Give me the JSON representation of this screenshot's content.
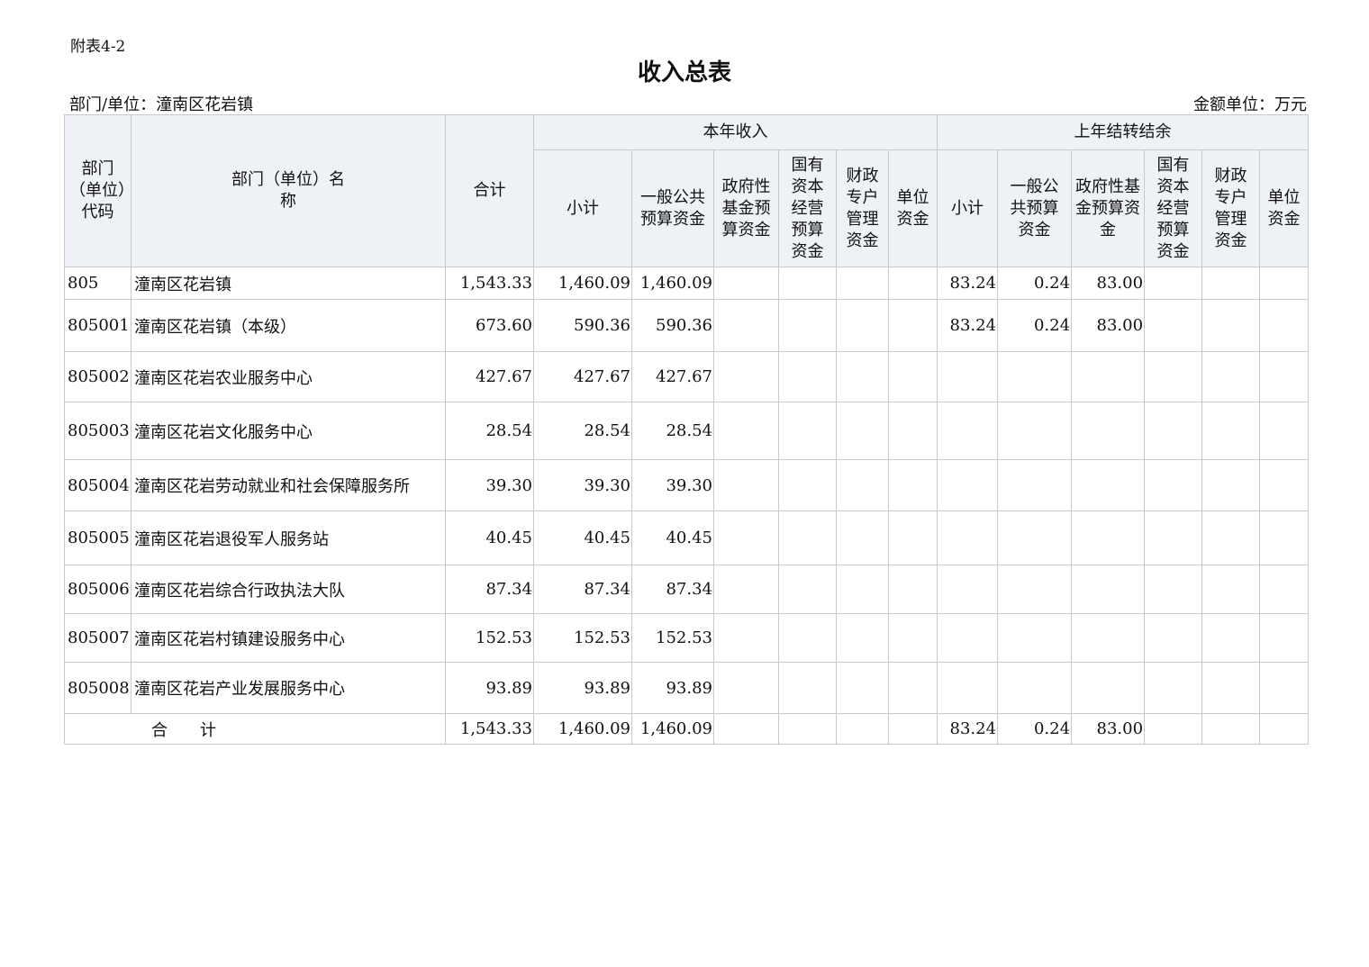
{
  "doc": {
    "attach_label": "附表4-2",
    "title": "收入总表",
    "dept_label": "部门/单位：潼南区花岩镇",
    "unit_label": "金额单位：万元"
  },
  "headers": {
    "code": "部门（单位）代码",
    "name": "部门（单位）名称",
    "total": "合计",
    "current_group": "本年收入",
    "prior_group": "上年结转结余",
    "cur": [
      "小计",
      "一般公共预算资金",
      "政府性基金预算资金",
      "国有资本经营预算资金",
      "财政专户管理资金",
      "单位资金"
    ],
    "prior": [
      "小计",
      "一般公共预算资金",
      "政府性基金预算资金",
      "国有资本经营预算资金",
      "财政专户管理资金",
      "单位资金"
    ]
  },
  "rows": [
    {
      "code": "805",
      "name": "潼南区花岩镇",
      "total": "1,543.33",
      "cur": [
        "1,460.09",
        "1,460.09",
        "",
        "",
        "",
        ""
      ],
      "prior": [
        "83.24",
        "0.24",
        "83.00",
        "",
        "",
        ""
      ]
    },
    {
      "code": "805001",
      "name": "潼南区花岩镇（本级）",
      "total": "673.60",
      "cur": [
        "590.36",
        "590.36",
        "",
        "",
        "",
        ""
      ],
      "prior": [
        "83.24",
        "0.24",
        "83.00",
        "",
        "",
        ""
      ]
    },
    {
      "code": "805002",
      "name": "潼南区花岩农业服务中心",
      "total": "427.67",
      "cur": [
        "427.67",
        "427.67",
        "",
        "",
        "",
        ""
      ],
      "prior": [
        "",
        "",
        "",
        "",
        "",
        ""
      ]
    },
    {
      "code": "805003",
      "name": "潼南区花岩文化服务中心",
      "total": "28.54",
      "cur": [
        "28.54",
        "28.54",
        "",
        "",
        "",
        ""
      ],
      "prior": [
        "",
        "",
        "",
        "",
        "",
        ""
      ]
    },
    {
      "code": "805004",
      "name": "潼南区花岩劳动就业和社会保障服务所",
      "total": "39.30",
      "cur": [
        "39.30",
        "39.30",
        "",
        "",
        "",
        ""
      ],
      "prior": [
        "",
        "",
        "",
        "",
        "",
        ""
      ]
    },
    {
      "code": "805005",
      "name": "潼南区花岩退役军人服务站",
      "total": "40.45",
      "cur": [
        "40.45",
        "40.45",
        "",
        "",
        "",
        ""
      ],
      "prior": [
        "",
        "",
        "",
        "",
        "",
        ""
      ]
    },
    {
      "code": "805006",
      "name": "潼南区花岩综合行政执法大队",
      "total": "87.34",
      "cur": [
        "87.34",
        "87.34",
        "",
        "",
        "",
        ""
      ],
      "prior": [
        "",
        "",
        "",
        "",
        "",
        ""
      ]
    },
    {
      "code": "805007",
      "name": "潼南区花岩村镇建设服务中心",
      "total": "152.53",
      "cur": [
        "152.53",
        "152.53",
        "",
        "",
        "",
        ""
      ],
      "prior": [
        "",
        "",
        "",
        "",
        "",
        ""
      ]
    },
    {
      "code": "805008",
      "name": "潼南区花岩产业发展服务中心",
      "total": "93.89",
      "cur": [
        "93.89",
        "93.89",
        "",
        "",
        "",
        ""
      ],
      "prior": [
        "",
        "",
        "",
        "",
        "",
        ""
      ]
    }
  ],
  "total_row": {
    "label": "合　　计",
    "total": "1,543.33",
    "cur": [
      "1,460.09",
      "1,460.09",
      "",
      "",
      "",
      ""
    ],
    "prior": [
      "83.24",
      "0.24",
      "83.00",
      "",
      "",
      ""
    ]
  }
}
